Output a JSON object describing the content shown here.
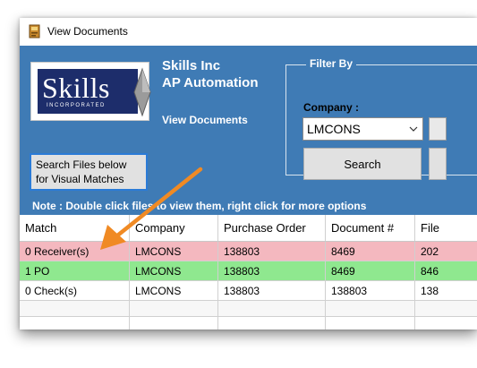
{
  "window": {
    "title": "View Documents",
    "icon": "app-icon"
  },
  "header": {
    "logo_word": "Skills",
    "logo_sub": "INCORPORATED",
    "company_name": "Skills Inc",
    "product_name": "AP Automation",
    "view_label": "View Documents",
    "background_color": "#3f7bb5"
  },
  "filter": {
    "legend": "Filter By",
    "company_label": "Company :",
    "company_value": "LMCONS",
    "search_label": "Search"
  },
  "visual_button": {
    "line1": "Search Files below",
    "line2": "for Visual Matches"
  },
  "note": "Note : Double click files to view them, right click for more options",
  "grid": {
    "columns": [
      "Match",
      "Company",
      "Purchase Order",
      "Document #",
      "File"
    ],
    "rows": [
      {
        "cells": [
          "0 Receiver(s)",
          "LMCONS",
          "138803",
          "8469",
          "202"
        ],
        "color": "#f4b8bf"
      },
      {
        "cells": [
          "1 PO",
          "LMCONS",
          "138803",
          "8469",
          "846"
        ],
        "color": "#8fe88f"
      },
      {
        "cells": [
          "0 Check(s)",
          "LMCONS",
          "138803",
          "138803",
          "138"
        ],
        "color": "#ffffff"
      }
    ]
  },
  "annotation": {
    "arrow_color": "#f08a24"
  }
}
